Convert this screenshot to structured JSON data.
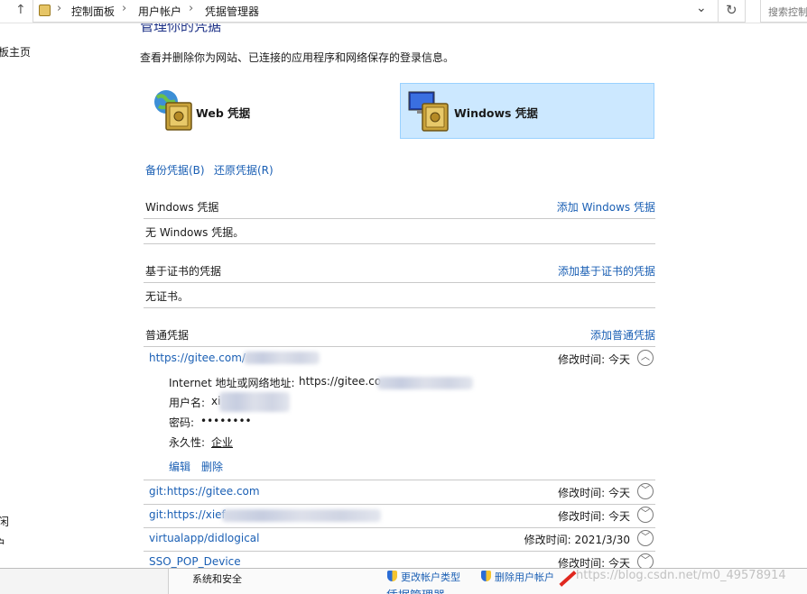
{
  "address_bar": {
    "breadcrumbs": [
      "控制面板",
      "用户帐户",
      "凭据管理器"
    ],
    "search_placeholder": "搜索控制"
  },
  "left_nav": {
    "items": [
      "板主页",
      "闲",
      "户"
    ]
  },
  "main": {
    "heading": "管理你的凭据",
    "description": "查看并删除你为网站、已连接的应用程序和网络保存的登录信息。",
    "tiles": [
      {
        "label": "Web 凭据",
        "icon": "globe-safe-icon"
      },
      {
        "label": "Windows 凭据",
        "icon": "monitor-safe-icon",
        "selected": true
      }
    ],
    "backup_label": "备份凭据(B)",
    "restore_label": "还原凭据(R)",
    "sections": {
      "windows": {
        "title": "Windows 凭据",
        "add": "添加 Windows 凭据",
        "empty": "无 Windows 凭据。"
      },
      "certificate": {
        "title": "基于证书的凭据",
        "add": "添加基于证书的凭据",
        "empty": "无证书。"
      },
      "generic": {
        "title": "普通凭据",
        "add": "添加普通凭据"
      }
    },
    "credentials": [
      {
        "name": "https://gitee.com/",
        "modified": "修改时间:  今天",
        "expanded": true
      },
      {
        "name": "git:https://gitee.com",
        "modified": "修改时间:  今天"
      },
      {
        "name": "git:https://xief",
        "modified": "修改时间:  今天"
      },
      {
        "name": "virtualapp/didlogical",
        "modified": "修改时间:  2021/3/30"
      },
      {
        "name": "SSO_POP_Device",
        "modified": "修改时间:  今天"
      }
    ],
    "expanded_detail": {
      "address_label": "Internet 地址或网络地址:",
      "address_value": "https://gitee.co",
      "username_label": "用户名:",
      "username_value": "xi",
      "password_label": "密码:",
      "password_value": "••••••••",
      "persistence_label": "永久性:",
      "persistence_value": "企业",
      "edit_label": "编辑",
      "delete_label": "删除"
    }
  },
  "bottom_window": {
    "category": "系统和安全",
    "link1": "更改帐户类型",
    "link2": "删除用户帐户",
    "link3": "凭据管理器"
  },
  "watermark": "https://blog.csdn.net/m0_49578914",
  "colors": {
    "link": "#1a5fb4",
    "selected_tile_bg": "#cce8ff",
    "selected_tile_border": "#99d1ff"
  }
}
